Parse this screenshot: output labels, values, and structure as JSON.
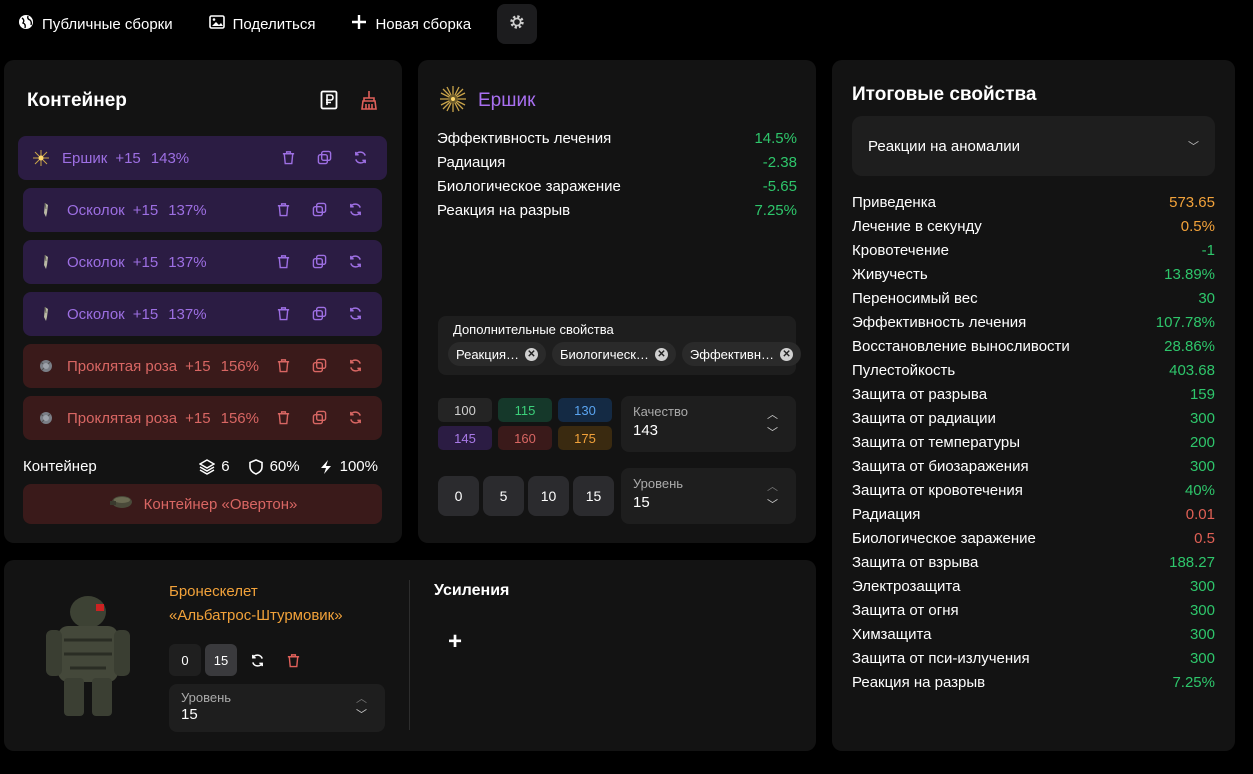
{
  "nav": {
    "public_builds": "Публичные сборки",
    "share": "Поделиться",
    "new_build": "Новая сборка"
  },
  "container_panel": {
    "title": "Контейнер",
    "items": [
      {
        "name": "Ершик",
        "level": "+15",
        "pct": "143%",
        "tone": "purple"
      },
      {
        "name": "Осколок",
        "level": "+15",
        "pct": "137%",
        "tone": "purple"
      },
      {
        "name": "Осколок",
        "level": "+15",
        "pct": "137%",
        "tone": "purple"
      },
      {
        "name": "Осколок",
        "level": "+15",
        "pct": "137%",
        "tone": "purple"
      },
      {
        "name": "Проклятая роза",
        "level": "+15",
        "pct": "156%",
        "tone": "red"
      },
      {
        "name": "Проклятая роза",
        "level": "+15",
        "pct": "156%",
        "tone": "red"
      }
    ],
    "footer_label": "Контейнер",
    "slots": "6",
    "protection": "60%",
    "efficiency": "100%",
    "container_name": "Контейнер «Овертон»"
  },
  "artifact_panel": {
    "name": "Ершик",
    "props": [
      {
        "label": "Эффективность лечения",
        "value": "14.5%",
        "color": "green"
      },
      {
        "label": "Радиация",
        "value": "-2.38",
        "color": "green"
      },
      {
        "label": "Биологическое заражение",
        "value": "-5.65",
        "color": "green"
      },
      {
        "label": "Реакция на разрыв",
        "value": "7.25%",
        "color": "green"
      }
    ],
    "extra_label": "Дополнительные свойства",
    "chips": [
      "Реакция…",
      "Биологическ…",
      "Эффективн…"
    ],
    "quality_options": [
      {
        "v": "100",
        "bg": "#242424",
        "fg": "#cfcfcf"
      },
      {
        "v": "115",
        "bg": "#15382a",
        "fg": "#3ccf7a"
      },
      {
        "v": "130",
        "bg": "#142a44",
        "fg": "#5aa4f0"
      },
      {
        "v": "145",
        "bg": "#2b1c43",
        "fg": "#a97ae8"
      },
      {
        "v": "160",
        "bg": "#3a1a1a",
        "fg": "#d86663"
      },
      {
        "v": "175",
        "bg": "#3a2a10",
        "fg": "#f2a23a"
      }
    ],
    "quality_label": "Качество",
    "quality_value": "143",
    "level_buttons": [
      "0",
      "5",
      "10",
      "15"
    ],
    "level_label": "Уровень",
    "level_value": "15"
  },
  "armor_panel": {
    "name_line1": "Бронескелет",
    "name_line2": "«Альбатрос-Штурмовик»",
    "btn_0": "0",
    "btn_15": "15",
    "level_label": "Уровень",
    "level_value": "15",
    "boosts_title": "Усиления",
    "add": "+"
  },
  "summary_panel": {
    "title": "Итоговые свойства",
    "select": "Реакции на аномалии",
    "rows": [
      {
        "label": "Приведенка",
        "value": "573.65",
        "color": "orange"
      },
      {
        "label": "Лечение в секунду",
        "value": "0.5%",
        "color": "orange"
      },
      {
        "label": "Кровотечение",
        "value": "-1",
        "color": "green"
      },
      {
        "label": "Живучесть",
        "value": "13.89%",
        "color": "green"
      },
      {
        "label": "Переносимый вес",
        "value": "30",
        "color": "green"
      },
      {
        "label": "Эффективность лечения",
        "value": "107.78%",
        "color": "green"
      },
      {
        "label": "Восстановление выносливости",
        "value": "28.86%",
        "color": "green"
      },
      {
        "label": "Пулестойкость",
        "value": "403.68",
        "color": "green"
      },
      {
        "label": "Защита от разрыва",
        "value": "159",
        "color": "green"
      },
      {
        "label": "Защита от радиации",
        "value": "300",
        "color": "green"
      },
      {
        "label": "Защита от температуры",
        "value": "200",
        "color": "green"
      },
      {
        "label": "Защита от биозаражения",
        "value": "300",
        "color": "green"
      },
      {
        "label": "Защита от кровотечения",
        "value": "40%",
        "color": "green"
      },
      {
        "label": "Радиация",
        "value": "0.01",
        "color": "red"
      },
      {
        "label": "Биологическое заражение",
        "value": "0.5",
        "color": "red"
      },
      {
        "label": "Защита от взрыва",
        "value": "188.27",
        "color": "green"
      },
      {
        "label": "Электрозащита",
        "value": "300",
        "color": "green"
      },
      {
        "label": "Защита от огня",
        "value": "300",
        "color": "green"
      },
      {
        "label": "Химзащита",
        "value": "300",
        "color": "green"
      },
      {
        "label": "Защита от пси-излучения",
        "value": "300",
        "color": "green"
      },
      {
        "label": "Реакция на разрыв",
        "value": "7.25%",
        "color": "green"
      }
    ]
  }
}
